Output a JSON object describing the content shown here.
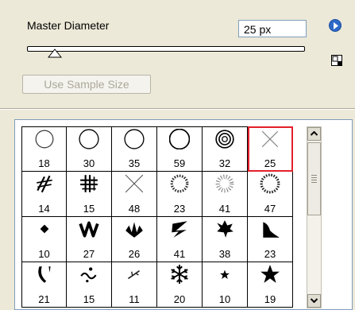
{
  "master_diameter": {
    "label": "Master Diameter",
    "value": "25 px",
    "slider_fraction": 0.1
  },
  "sample_size_button": {
    "label": "Use Sample Size",
    "enabled": false
  },
  "menu_icon": "right-arrow-circle-icon",
  "new_preset_icon": "new-preset-icon",
  "selection_color": "#E3202A",
  "brushes": [
    {
      "size": "18",
      "icon": "circle-hard-small"
    },
    {
      "size": "30",
      "icon": "circle-hard"
    },
    {
      "size": "35",
      "icon": "circle-hard"
    },
    {
      "size": "59",
      "icon": "circle-hard-large"
    },
    {
      "size": "32",
      "icon": "circle-double"
    },
    {
      "size": "25",
      "icon": "cross-thin",
      "selected": true
    },
    {
      "size": "14",
      "icon": "hatch-marks"
    },
    {
      "size": "15",
      "icon": "grid-hash"
    },
    {
      "size": "48",
      "icon": "cross-light"
    },
    {
      "size": "23",
      "icon": "dotted-ring"
    },
    {
      "size": "41",
      "icon": "burst-ring"
    },
    {
      "size": "47",
      "icon": "dotted-ring-large"
    },
    {
      "size": "10",
      "icon": "diamond-small"
    },
    {
      "size": "27",
      "icon": "zigzag-bold"
    },
    {
      "size": "26",
      "icon": "grass-leaves"
    },
    {
      "size": "41",
      "icon": "brush-stroke"
    },
    {
      "size": "38",
      "icon": "maple-leaf"
    },
    {
      "size": "23",
      "icon": "ramp-shape"
    },
    {
      "size": "21",
      "icon": "feather-curve"
    },
    {
      "size": "15",
      "icon": "squiggle-dots"
    },
    {
      "size": "11",
      "icon": "small-twig"
    },
    {
      "size": "20",
      "icon": "snowflake"
    },
    {
      "size": "10",
      "icon": "star-small"
    },
    {
      "size": "19",
      "icon": "star-large"
    }
  ]
}
